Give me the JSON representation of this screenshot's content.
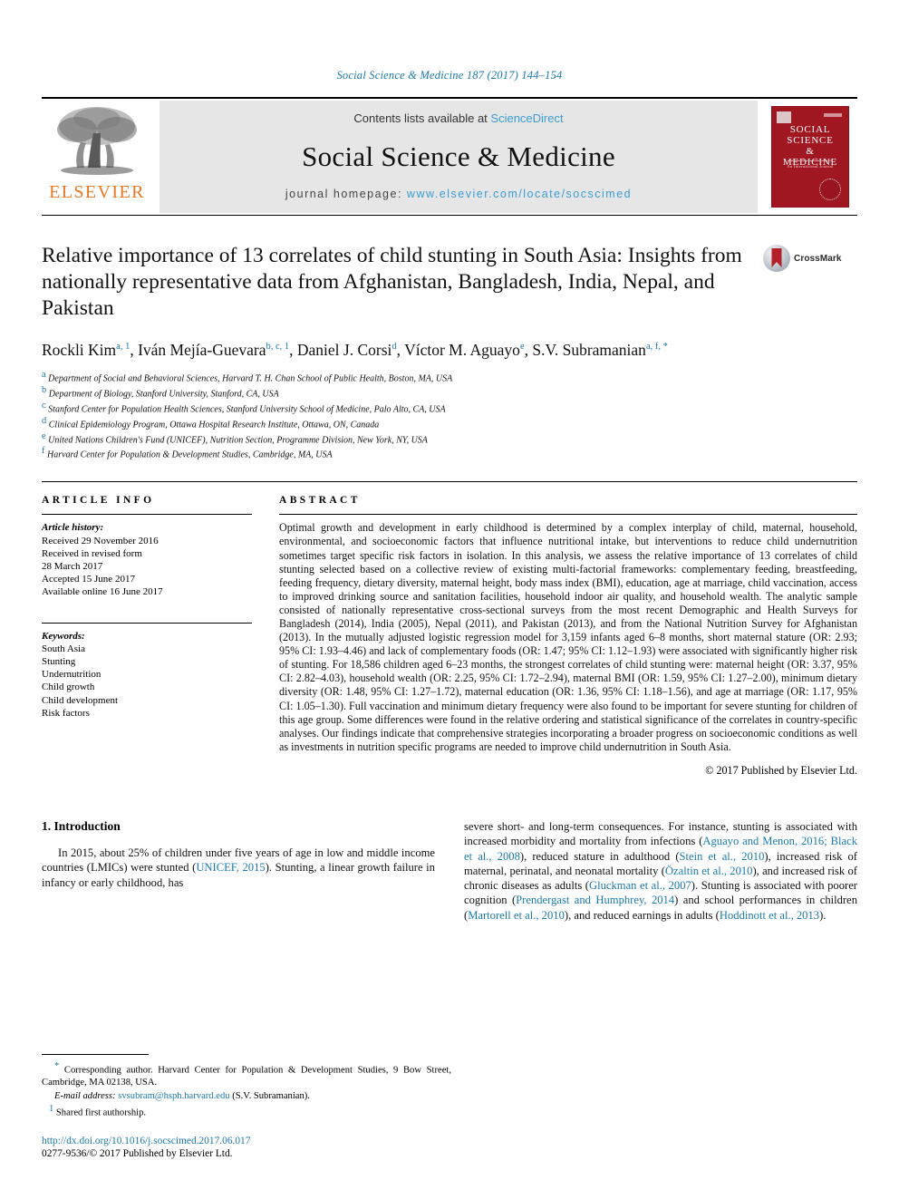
{
  "running_head": "Social Science & Medicine 187 (2017) 144–154",
  "masthead": {
    "publisher": "ELSEVIER",
    "contents_prefix": "Contents lists available at ",
    "contents_link": "ScienceDirect",
    "journal_name": "Social Science & Medicine",
    "homepage_prefix": "journal homepage: ",
    "homepage_url": "www.elsevier.com/locate/socscimed",
    "cover_title": "SOCIAL SCIENCE & MEDICINE"
  },
  "article": {
    "title": "Relative importance of 13 correlates of child stunting in South Asia: Insights from nationally representative data from Afghanistan, Bangladesh, India, Nepal, and Pakistan",
    "crossmark_label": "CrossMark",
    "authors_line1": "Rockli Kim",
    "authors": [
      {
        "name": "Rockli Kim",
        "sup": "a, 1"
      },
      {
        "name": "Iván Mejía-Guevara",
        "sup": "b, c, 1"
      },
      {
        "name": "Daniel J. Corsi",
        "sup": "d"
      },
      {
        "name": "Víctor M. Aguayo",
        "sup": "e"
      },
      {
        "name": "S.V. Subramanian",
        "sup": "a, f, *"
      }
    ],
    "affiliations": [
      {
        "mark": "a",
        "text": "Department of Social and Behavioral Sciences, Harvard T. H. Chan School of Public Health, Boston, MA, USA"
      },
      {
        "mark": "b",
        "text": "Department of Biology, Stanford University, Stanford, CA, USA"
      },
      {
        "mark": "c",
        "text": "Stanford Center for Population Health Sciences, Stanford University School of Medicine, Palo Alto, CA, USA"
      },
      {
        "mark": "d",
        "text": "Clinical Epidemiology Program, Ottawa Hospital Research Institute, Ottawa, ON, Canada"
      },
      {
        "mark": "e",
        "text": "United Nations Children's Fund (UNICEF), Nutrition Section, Programme Division, New York, NY, USA"
      },
      {
        "mark": "f",
        "text": "Harvard Center for Population & Development Studies, Cambridge, MA, USA"
      }
    ]
  },
  "article_info": {
    "heading": "ARTICLE INFO",
    "history_label": "Article history:",
    "history": [
      "Received 29 November 2016",
      "Received in revised form",
      "28 March 2017",
      "Accepted 15 June 2017",
      "Available online 16 June 2017"
    ],
    "keywords_label": "Keywords:",
    "keywords": [
      "South Asia",
      "Stunting",
      "Undernutrition",
      "Child growth",
      "Child development",
      "Risk factors"
    ]
  },
  "abstract": {
    "heading": "ABSTRACT",
    "text": "Optimal growth and development in early childhood is determined by a complex interplay of child, maternal, household, environmental, and socioeconomic factors that influence nutritional intake, but interventions to reduce child undernutrition sometimes target specific risk factors in isolation. In this analysis, we assess the relative importance of 13 correlates of child stunting selected based on a collective review of existing multi-factorial frameworks: complementary feeding, breastfeeding, feeding frequency, dietary diversity, maternal height, body mass index (BMI), education, age at marriage, child vaccination, access to improved drinking source and sanitation facilities, household indoor air quality, and household wealth. The analytic sample consisted of nationally representative cross-sectional surveys from the most recent Demographic and Health Surveys for Bangladesh (2014), India (2005), Nepal (2011), and Pakistan (2013), and from the National Nutrition Survey for Afghanistan (2013). In the mutually adjusted logistic regression model for 3,159 infants aged 6–8 months, short maternal stature (OR: 2.93; 95% CI: 1.93–4.46) and lack of complementary foods (OR: 1.47; 95% CI: 1.12–1.93) were associated with significantly higher risk of stunting. For 18,586 children aged 6–23 months, the strongest correlates of child stunting were: maternal height (OR: 3.37, 95% CI: 2.82–4.03), household wealth (OR: 2.25, 95% CI: 1.72–2.94), maternal BMI (OR: 1.59, 95% CI: 1.27–2.00), minimum dietary diversity (OR: 1.48, 95% CI: 1.27–1.72), maternal education (OR: 1.36, 95% CI: 1.18–1.56), and age at marriage (OR: 1.17, 95% CI: 1.05–1.30). Full vaccination and minimum dietary frequency were also found to be important for severe stunting for children of this age group. Some differences were found in the relative ordering and statistical significance of the correlates in country-specific analyses. Our findings indicate that comprehensive strategies incorporating a broader progress on socioeconomic conditions as well as investments in nutrition specific programs are needed to improve child undernutrition in South Asia.",
    "copyright": "© 2017 Published by Elsevier Ltd."
  },
  "introduction": {
    "heading": "1. Introduction",
    "left_text_before_link": "In 2015, about 25% of children under five years of age in low and middle income countries (LMICs) were stunted (",
    "left_link": "UNICEF, 2015",
    "left_text_after_link": "). Stunting, a linear growth failure in infancy or early childhood, has",
    "right_segments": [
      {
        "type": "text",
        "value": "severe short- and long-term consequences. For instance, stunting is associated with increased morbidity and mortality from infections ("
      },
      {
        "type": "link",
        "value": "Aguayo and Menon, 2016; Black et al., 2008"
      },
      {
        "type": "text",
        "value": "), reduced stature in adulthood ("
      },
      {
        "type": "link",
        "value": "Stein et al., 2010"
      },
      {
        "type": "text",
        "value": "), increased risk of maternal, perinatal, and neonatal mortality ("
      },
      {
        "type": "link",
        "value": "Özaltin et al., 2010"
      },
      {
        "type": "text",
        "value": "), and increased risk of chronic diseases as adults ("
      },
      {
        "type": "link",
        "value": "Gluckman et al., 2007"
      },
      {
        "type": "text",
        "value": "). Stunting is associated with poorer cognition ("
      },
      {
        "type": "link",
        "value": "Prendergast and Humphrey, 2014"
      },
      {
        "type": "text",
        "value": ") and school performances in children ("
      },
      {
        "type": "link",
        "value": "Martorell et al., 2010"
      },
      {
        "type": "text",
        "value": "), and reduced earnings in adults ("
      },
      {
        "type": "link",
        "value": "Hoddinott et al., 2013"
      },
      {
        "type": "text",
        "value": ")."
      }
    ]
  },
  "footnotes": {
    "corresponding_mark": "*",
    "corresponding": "Corresponding author. Harvard Center for Population & Development Studies, 9 Bow Street, Cambridge, MA 02138, USA.",
    "email_label": "E-mail address:",
    "email": "svsubram@hsph.harvard.edu",
    "email_suffix": "(S.V. Subramanian).",
    "shared_mark": "1",
    "shared": "Shared first authorship.",
    "doi": "http://dx.doi.org/10.1016/j.socscimed.2017.06.017",
    "issn": "0277-9536/© 2017 Published by Elsevier Ltd."
  },
  "colors": {
    "link_blue": "#1a7aad",
    "sciencedirect_blue": "#3c9cd7",
    "elsevier_orange": "#e87722",
    "cover_red": "#a01722"
  }
}
